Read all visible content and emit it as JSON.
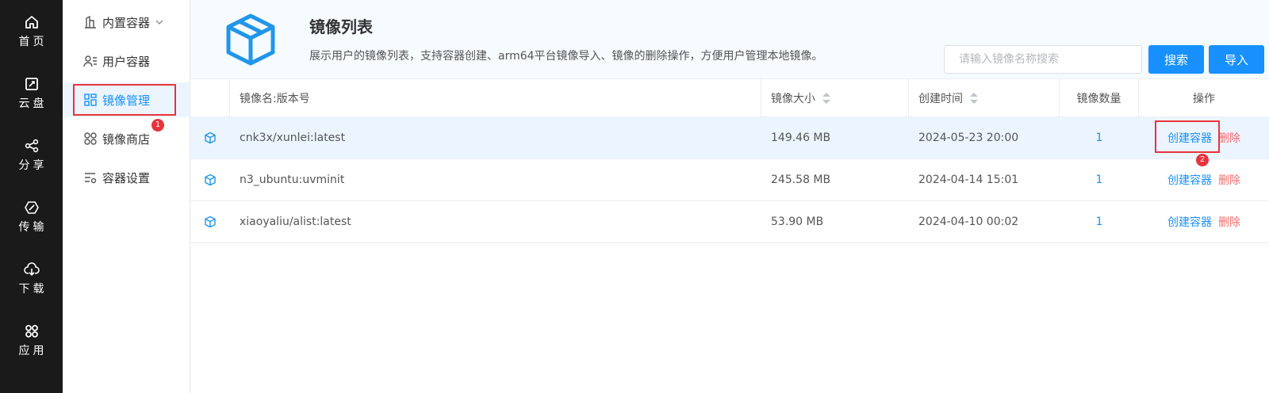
{
  "nav": {
    "items": [
      {
        "label": "首页",
        "icon": "home-icon"
      },
      {
        "label": "云盘",
        "icon": "cloud-disk-icon"
      },
      {
        "label": "分享",
        "icon": "share-icon"
      },
      {
        "label": "传输",
        "icon": "transfer-icon"
      },
      {
        "label": "下载",
        "icon": "download-icon"
      },
      {
        "label": "应用",
        "icon": "apps-icon"
      }
    ]
  },
  "subnav": {
    "items": [
      {
        "label": "内置容器",
        "icon": "building-icon"
      },
      {
        "label": "用户容器",
        "icon": "user-list-icon"
      },
      {
        "label": "镜像管理",
        "icon": "grid-icon"
      },
      {
        "label": "镜像商店",
        "icon": "store-icon"
      },
      {
        "label": "容器设置",
        "icon": "settings-list-icon"
      }
    ],
    "active_index": 2
  },
  "header": {
    "title": "镜像列表",
    "description": "展示用户的镜像列表，支持容器创建、arm64平台镜像导入、镜像的删除操作，方便用户管理本地镜像。",
    "search_placeholder": "请输入镜像名称搜索",
    "search_button": "搜索",
    "import_button": "导入"
  },
  "table": {
    "columns": {
      "name": "镜像名:版本号",
      "size": "镜像大小",
      "time": "创建时间",
      "count": "镜像数量",
      "ops": "操作"
    },
    "rows": [
      {
        "name": "cnk3x/xunlei:latest",
        "size": "149.46 MB",
        "time": "2024-05-23 20:00",
        "count": "1",
        "create": "创建容器",
        "delete": "删除"
      },
      {
        "name": "n3_ubuntu:uvminit",
        "size": "245.58 MB",
        "time": "2024-04-14 15:01",
        "count": "1",
        "create": "创建容器",
        "delete": "删除"
      },
      {
        "name": "xiaoyaliu/alist:latest",
        "size": "53.90 MB",
        "time": "2024-04-10 00:02",
        "count": "1",
        "create": "创建容器",
        "delete": "删除"
      }
    ]
  },
  "annotations": {
    "badge_1": "1",
    "badge_2": "2"
  },
  "colors": {
    "accent": "#1890ff",
    "danger": "#f56c6c",
    "annotation": "#e8343c",
    "nav_bg": "#1a1a1a"
  }
}
